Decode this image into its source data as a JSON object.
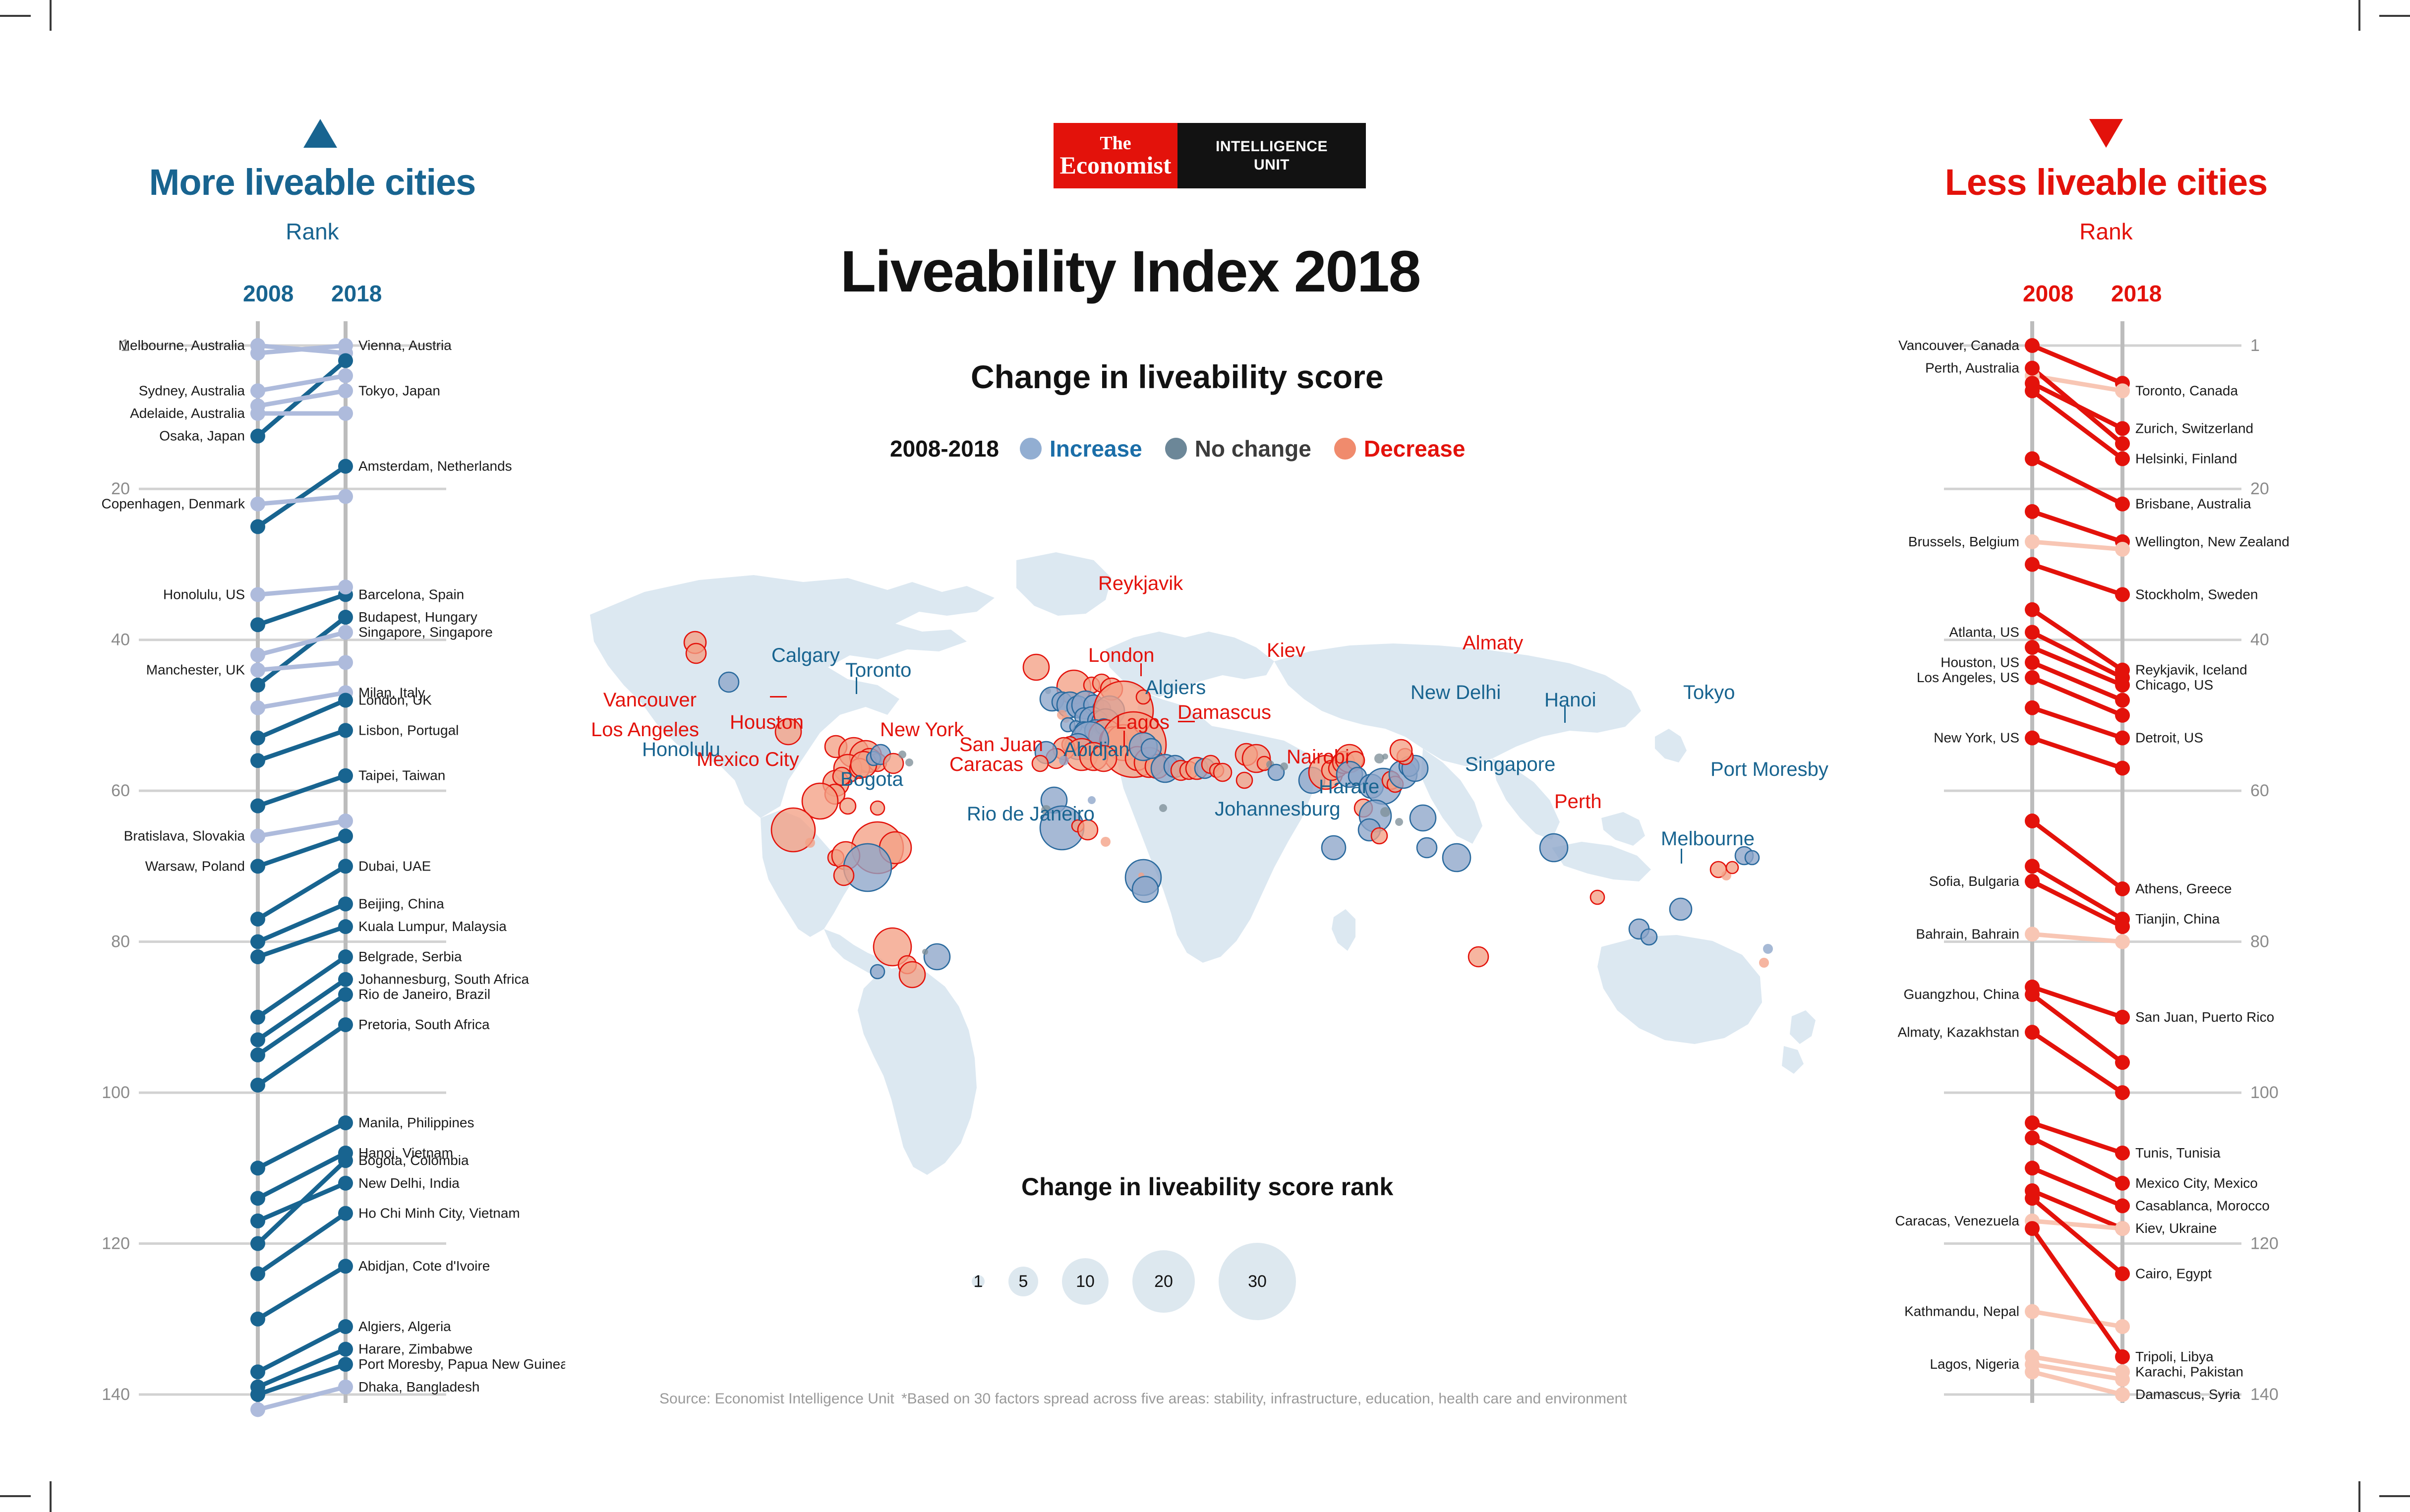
{
  "brand": {
    "line1": "The",
    "line2": "Economist",
    "line3": "INTELLIGENCE",
    "line4": "UNIT"
  },
  "header": {
    "title": "Liveability Index 2018",
    "subtitle": "Change in liveability score"
  },
  "legend": {
    "years": "2008-2018",
    "items": [
      {
        "label": "Increase",
        "color": "#92aed2",
        "text_color": "#1b6ea8"
      },
      {
        "label": "No change",
        "color": "#6c8798",
        "text_color": "#3c3c3c"
      },
      {
        "label": "Decrease",
        "color": "#f08b6d",
        "text_color": "#e3120b"
      }
    ]
  },
  "bubble_legend": {
    "title": "Change in liveability score rank",
    "sizes": [
      {
        "label": "1",
        "d": 26
      },
      {
        "label": "5",
        "d": 60
      },
      {
        "label": "10",
        "d": 94
      },
      {
        "label": "20",
        "d": 126
      },
      {
        "label": "30",
        "d": 156
      }
    ]
  },
  "footer": {
    "source": "Source: Economist Intelligence Unit",
    "note": "*Based on 30 factors spread across five areas: stability, infrastructure, education, health care and environment"
  },
  "left_panel": {
    "title": "More liveable cities",
    "subtitle": "Rank",
    "year_left": "2008",
    "year_right": "2018",
    "color": "#186490",
    "ticks": [
      "1",
      "20",
      "40",
      "60",
      "80",
      "100",
      "120",
      "140"
    ]
  },
  "right_panel": {
    "title": "Less liveable cities",
    "subtitle": "Rank",
    "year_left": "2008",
    "year_right": "2018",
    "color": "#e3120b",
    "ticks": [
      "1",
      "20",
      "40",
      "60",
      "80",
      "100",
      "120",
      "140"
    ]
  },
  "chart_data": {
    "type": "line",
    "title": "Liveability Index 2018 — change in rank 2008 to 2018",
    "xlabel": "",
    "ylabel": "Rank",
    "x": [
      "2008",
      "2018"
    ],
    "ylim": [
      1,
      143
    ],
    "grid": true,
    "legend_position": "top-center",
    "panels": [
      {
        "name": "More liveable cities",
        "direction": "improved",
        "color": "#186490",
        "series": [
          {
            "name": "Vienna, Austria",
            "r2008": 2,
            "r2018": 1,
            "label_side": "right"
          },
          {
            "name": "Melbourne, Australia",
            "r2008": 1,
            "r2018": 2,
            "label_side": "left"
          },
          {
            "name": "Osaka, Japan",
            "r2008": 13,
            "r2018": 3,
            "label_side": "left"
          },
          {
            "name": "Tokyo, Japan",
            "r2008": 9,
            "r2018": 7,
            "label_side": "right"
          },
          {
            "name": "Sydney, Australia",
            "r2008": 7,
            "r2018": 5,
            "label_side": "left"
          },
          {
            "name": "Adelaide, Australia",
            "r2008": 10,
            "r2018": 10,
            "label_side": "left"
          },
          {
            "name": "Amsterdam, Netherlands",
            "r2008": 25,
            "r2018": 17,
            "label_side": "right"
          },
          {
            "name": "Copenhagen, Denmark",
            "r2008": 22,
            "r2018": 21,
            "label_side": "left"
          },
          {
            "name": "Barcelona, Spain",
            "r2008": 38,
            "r2018": 34,
            "label_side": "right"
          },
          {
            "name": "Budapest, Hungary",
            "r2008": 46,
            "r2018": 37,
            "label_side": "right"
          },
          {
            "name": "Singapore, Singapore",
            "r2008": 42,
            "r2018": 39,
            "label_side": "right"
          },
          {
            "name": "Honolulu, US",
            "r2008": 34,
            "r2018": 33,
            "label_side": "left"
          },
          {
            "name": "Milan, Italy",
            "r2008": 49,
            "r2018": 47,
            "label_side": "right"
          },
          {
            "name": "Manchester, UK",
            "r2008": 44,
            "r2018": 43,
            "label_side": "left"
          },
          {
            "name": "London, UK",
            "r2008": 53,
            "r2018": 48,
            "label_side": "right"
          },
          {
            "name": "Lisbon, Portugal",
            "r2008": 56,
            "r2018": 52,
            "label_side": "right"
          },
          {
            "name": "Taipei, Taiwan",
            "r2008": 62,
            "r2018": 58,
            "label_side": "right"
          },
          {
            "name": "Bratislava, Slovakia",
            "r2008": 66,
            "r2018": 64,
            "label_side": "left"
          },
          {
            "name": "Dubai, UAE",
            "r2008": 77,
            "r2018": 70,
            "label_side": "right"
          },
          {
            "name": "Warsaw, Poland",
            "r2008": 70,
            "r2018": 66,
            "label_side": "left"
          },
          {
            "name": "Beijing, China",
            "r2008": 80,
            "r2018": 75,
            "label_side": "right"
          },
          {
            "name": "Kuala Lumpur, Malaysia",
            "r2008": 82,
            "r2018": 78,
            "label_side": "right"
          },
          {
            "name": "Belgrade, Serbia",
            "r2008": 90,
            "r2018": 82,
            "label_side": "right"
          },
          {
            "name": "Johannesburg, South Africa",
            "r2008": 93,
            "r2018": 85,
            "label_side": "right"
          },
          {
            "name": "Rio de Janeiro, Brazil",
            "r2008": 95,
            "r2018": 87,
            "label_side": "right"
          },
          {
            "name": "Pretoria, South Africa",
            "r2008": 99,
            "r2018": 91,
            "label_side": "right"
          },
          {
            "name": "Manila, Philippines",
            "r2008": 110,
            "r2018": 104,
            "label_side": "right"
          },
          {
            "name": "Hanoi, Vietnam",
            "r2008": 114,
            "r2018": 108,
            "label_side": "right"
          },
          {
            "name": "Bogota, Colombia",
            "r2008": 120,
            "r2018": 109,
            "label_side": "right"
          },
          {
            "name": "New Delhi, India",
            "r2008": 117,
            "r2018": 112,
            "label_side": "right"
          },
          {
            "name": "Ho Chi Minh City, Vietnam",
            "r2008": 124,
            "r2018": 116,
            "label_side": "right"
          },
          {
            "name": "Abidjan, Cote d'Ivoire",
            "r2008": 130,
            "r2018": 123,
            "label_side": "right"
          },
          {
            "name": "Algiers, Algeria",
            "r2008": 137,
            "r2018": 131,
            "label_side": "right"
          },
          {
            "name": "Harare, Zimbabwe",
            "r2008": 139,
            "r2018": 134,
            "label_side": "right"
          },
          {
            "name": "Port Moresby, Papua New Guinea",
            "r2008": 140,
            "r2018": 136,
            "label_side": "right"
          },
          {
            "name": "Dhaka, Bangladesh",
            "r2008": 142,
            "r2018": 139,
            "label_side": "right"
          }
        ]
      },
      {
        "name": "Less liveable cities",
        "direction": "worsened",
        "color": "#e3120b",
        "series": [
          {
            "name": "Vancouver, Canada",
            "r2008": 1,
            "r2018": 6,
            "label_side": "left"
          },
          {
            "name": "Toronto, Canada",
            "r2008": 5,
            "r2018": 7,
            "label_side": "right"
          },
          {
            "name": "Perth, Australia",
            "r2008": 4,
            "r2018": 14,
            "label_side": "left"
          },
          {
            "name": "Zurich, Switzerland",
            "r2008": 6,
            "r2018": 12,
            "label_side": "right"
          },
          {
            "name": "Helsinki, Finland",
            "r2008": 7,
            "r2018": 16,
            "label_side": "right"
          },
          {
            "name": "Brisbane, Australia",
            "r2008": 16,
            "r2018": 22,
            "label_side": "right"
          },
          {
            "name": "Wellington, New Zealand",
            "r2008": 23,
            "r2018": 27,
            "label_side": "right"
          },
          {
            "name": "Stockholm, Sweden",
            "r2008": 30,
            "r2018": 34,
            "label_side": "right"
          },
          {
            "name": "Brussels, Belgium",
            "r2008": 27,
            "r2018": 28,
            "label_side": "left"
          },
          {
            "name": "Atlanta, US",
            "r2008": 39,
            "r2018": 45,
            "label_side": "left"
          },
          {
            "name": "Reykjavik, Iceland",
            "r2008": 36,
            "r2018": 44,
            "label_side": "right"
          },
          {
            "name": "Chicago, US",
            "r2008": 41,
            "r2018": 46,
            "label_side": "right"
          },
          {
            "name": "Houston, US",
            "r2008": 43,
            "r2018": 48,
            "label_side": "left"
          },
          {
            "name": "Los Angeles, US",
            "r2008": 45,
            "r2018": 50,
            "label_side": "left"
          },
          {
            "name": "Detroit, US",
            "r2008": 49,
            "r2018": 53,
            "label_side": "right"
          },
          {
            "name": "New York, US",
            "r2008": 53,
            "r2018": 57,
            "label_side": "left"
          },
          {
            "name": "Athens, Greece",
            "r2008": 64,
            "r2018": 73,
            "label_side": "right"
          },
          {
            "name": "Sofia, Bulgaria",
            "r2008": 72,
            "r2018": 78,
            "label_side": "left"
          },
          {
            "name": "Tianjin, China",
            "r2008": 70,
            "r2018": 77,
            "label_side": "right"
          },
          {
            "name": "Bahrain, Bahrain",
            "r2008": 79,
            "r2018": 80,
            "label_side": "left"
          },
          {
            "name": "San Juan, Puerto Rico",
            "r2008": 86,
            "r2018": 90,
            "label_side": "right"
          },
          {
            "name": "Guangzhou, China",
            "r2008": 87,
            "r2018": 96,
            "label_side": "left"
          },
          {
            "name": "Almaty, Kazakhstan",
            "r2008": 92,
            "r2018": 100,
            "label_side": "left"
          },
          {
            "name": "Tunis, Tunisia",
            "r2008": 104,
            "r2018": 108,
            "label_side": "right"
          },
          {
            "name": "Mexico City, Mexico",
            "r2008": 106,
            "r2018": 112,
            "label_side": "right"
          },
          {
            "name": "Casablanca, Morocco",
            "r2008": 110,
            "r2018": 115,
            "label_side": "right"
          },
          {
            "name": "Kiev, Ukraine",
            "r2008": 113,
            "r2018": 118,
            "label_side": "right"
          },
          {
            "name": "Caracas, Venezuela",
            "r2008": 117,
            "r2018": 118,
            "label_side": "left"
          },
          {
            "name": "Cairo, Egypt",
            "r2008": 114,
            "r2018": 124,
            "label_side": "right"
          },
          {
            "name": "Kathmandu, Nepal",
            "r2008": 129,
            "r2018": 131,
            "label_side": "left"
          },
          {
            "name": "Tripoli, Libya",
            "r2008": 118,
            "r2018": 135,
            "label_side": "right"
          },
          {
            "name": "Karachi, Pakistan",
            "r2008": 135,
            "r2018": 137,
            "label_side": "right"
          },
          {
            "name": "Lagos, Nigeria",
            "r2008": 136,
            "r2018": 138,
            "label_side": "left"
          },
          {
            "name": "Damascus, Syria",
            "r2008": 137,
            "r2018": 140,
            "label_side": "right"
          }
        ]
      }
    ],
    "map_bubbles": {
      "note": "Bubble area = change in liveability score rank; blue = increase, orange/red = decrease, grey = no change",
      "labelled": [
        {
          "name": "Vancouver",
          "color": "decrease"
        },
        {
          "name": "Calgary",
          "color": "increase"
        },
        {
          "name": "Toronto",
          "color": "increase"
        },
        {
          "name": "Los Angeles",
          "color": "decrease"
        },
        {
          "name": "Houston",
          "color": "decrease"
        },
        {
          "name": "New York",
          "color": "decrease"
        },
        {
          "name": "San Juan",
          "color": "decrease"
        },
        {
          "name": "Honolulu",
          "color": "increase"
        },
        {
          "name": "Mexico City",
          "color": "decrease"
        },
        {
          "name": "Caracas",
          "color": "decrease"
        },
        {
          "name": "Bogota",
          "color": "increase"
        },
        {
          "name": "Rio de Janeiro",
          "color": "increase"
        },
        {
          "name": "Reykjavik",
          "color": "decrease"
        },
        {
          "name": "London",
          "color": "decrease"
        },
        {
          "name": "Kiev",
          "color": "decrease"
        },
        {
          "name": "Algiers",
          "color": "increase"
        },
        {
          "name": "Damascus",
          "color": "decrease"
        },
        {
          "name": "Lagos",
          "color": "increase"
        },
        {
          "name": "Abidjan",
          "color": "increase"
        },
        {
          "name": "Nairobi",
          "color": "decrease"
        },
        {
          "name": "Harare",
          "color": "increase"
        },
        {
          "name": "Johannesburg",
          "color": "increase"
        },
        {
          "name": "Almaty",
          "color": "decrease"
        },
        {
          "name": "New Delhi",
          "color": "increase"
        },
        {
          "name": "Hanoi",
          "color": "increase"
        },
        {
          "name": "Singapore",
          "color": "increase"
        },
        {
          "name": "Tokyo",
          "color": "increase"
        },
        {
          "name": "Port Moresby",
          "color": "increase"
        },
        {
          "name": "Perth",
          "color": "decrease"
        },
        {
          "name": "Melbourne",
          "color": "increase"
        }
      ]
    }
  }
}
